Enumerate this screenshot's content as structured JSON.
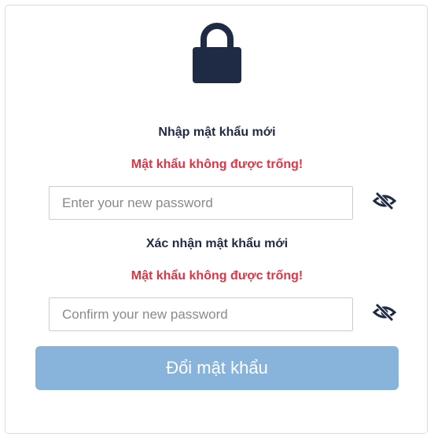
{
  "lock_icon": "lock-icon",
  "colors": {
    "icon": "#1f2a44",
    "error": "#dc3545",
    "button": "#88b4dc"
  },
  "new_password": {
    "label": "Nhập mật khẩu mới",
    "error": "Mật khẩu không được trống!",
    "value": "",
    "placeholder": "Enter your new password",
    "toggle_icon": "eye-slash-icon"
  },
  "confirm_password": {
    "label": "Xác nhận mật khẩu mới",
    "error": "Mật khẩu không được trống!",
    "value": "",
    "placeholder": "Confirm your new password",
    "toggle_icon": "eye-slash-icon"
  },
  "submit_label": "Đổi mật khẩu"
}
